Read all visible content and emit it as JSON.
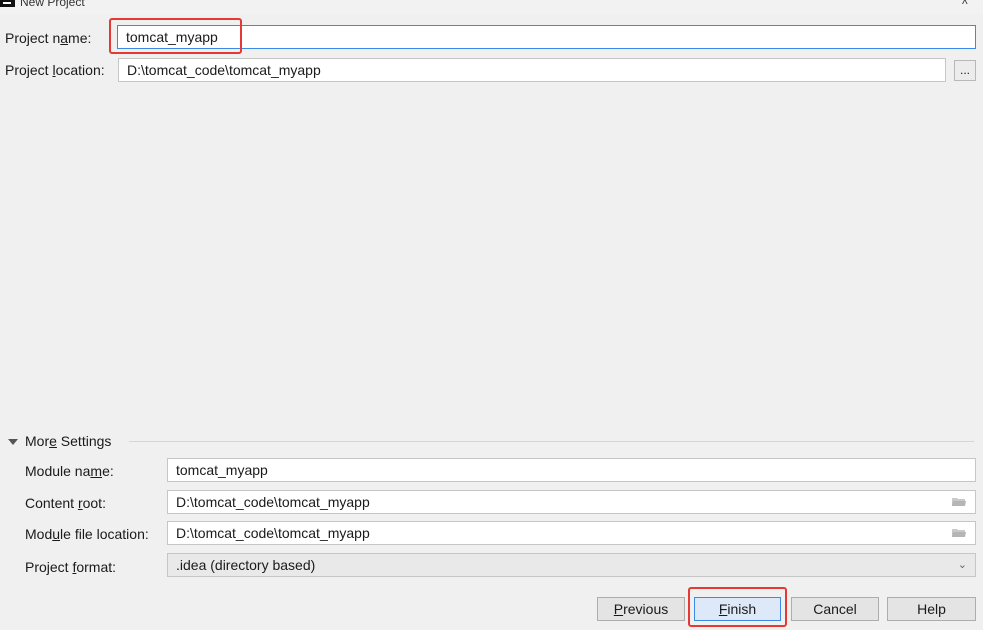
{
  "window": {
    "title": "New Project",
    "collapse_glyph": "^"
  },
  "project_name": {
    "label_pre": "Project n",
    "label_mn": "a",
    "label_post": "me:",
    "value": "tomcat_myapp"
  },
  "project_location": {
    "label_pre": "Project ",
    "label_mn": "l",
    "label_post": "ocation:",
    "value": "D:\\tomcat_code\\tomcat_myapp",
    "browse_label": "..."
  },
  "more_settings": {
    "label_pre": "Mor",
    "label_mn": "e",
    "label_post": " Settings",
    "module_name": {
      "label_pre": "Module na",
      "label_mn": "m",
      "label_post": "e:",
      "value": "tomcat_myapp"
    },
    "content_root": {
      "label_pre": "Content ",
      "label_mn": "r",
      "label_post": "oot:",
      "value": "D:\\tomcat_code\\tomcat_myapp"
    },
    "module_file_location": {
      "label_pre": "Mod",
      "label_mn": "u",
      "label_post": "le file location:",
      "value": "D:\\tomcat_code\\tomcat_myapp"
    },
    "project_format": {
      "label_pre": "Project ",
      "label_mn": "f",
      "label_post": "ormat:",
      "value": ".idea (directory based)"
    }
  },
  "buttons": {
    "previous": {
      "mn": "P",
      "rest": "revious"
    },
    "finish": {
      "mn": "F",
      "rest": "inish"
    },
    "cancel": "Cancel",
    "help": "Help"
  },
  "colors": {
    "highlight": "#e53935",
    "focus": "#3d8ae6",
    "background": "#f0f0f0"
  }
}
